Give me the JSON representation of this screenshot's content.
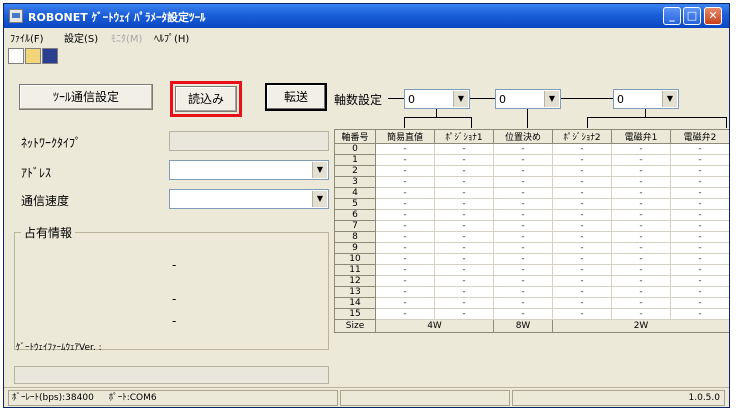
{
  "window": {
    "title": "ROBONET ｹﾞｰﾄｳｪｲ ﾊﾟﾗﾒｰﾀ設定ﾂｰﾙ"
  },
  "menu": [
    "ﾌｧｲﾙ(F)",
    "設定(S)",
    "ﾓﾆﾀ(M)",
    "ﾍﾙﾌﾟ(H)"
  ],
  "buttons": {
    "comm_settings": "ﾂｰﾙ通信設定",
    "read": "読込み",
    "transfer": "転送"
  },
  "left": {
    "network_type_label": "ﾈｯﾄﾜｰｸﾀｲﾌﾟ",
    "address_label": "ｱﾄﾞﾚｽ",
    "speed_label": "通信速度",
    "occupancy_title": "占有情報",
    "occupancy_values": [
      "-",
      "-",
      "-"
    ],
    "firmware_label": "ｹﾞｰﾄｳｪｲﾌｧｰﾑｳｪｱVer. :"
  },
  "axis": {
    "label": "軸数設定",
    "selects": [
      "0",
      "0",
      "0"
    ],
    "columns": [
      "軸番号",
      "簡易直値",
      "ﾎﾟｼﾞｼｮﾅ1",
      "位置決め",
      "ﾎﾟｼﾞｼｮﾅ2",
      "電磁弁1",
      "電磁弁2"
    ],
    "rows": [
      "0",
      "1",
      "2",
      "3",
      "4",
      "5",
      "6",
      "7",
      "8",
      "9",
      "10",
      "11",
      "12",
      "13",
      "14",
      "15"
    ],
    "cell_value": "-",
    "size_label": "Size",
    "sizes": [
      "4W",
      "8W",
      "2W"
    ]
  },
  "status": {
    "baud": "ﾎﾞｰﾚｰﾄ(bps):38400",
    "port": "ﾎﾟｰﾄ:COM6",
    "version": "1.0.5.0"
  }
}
